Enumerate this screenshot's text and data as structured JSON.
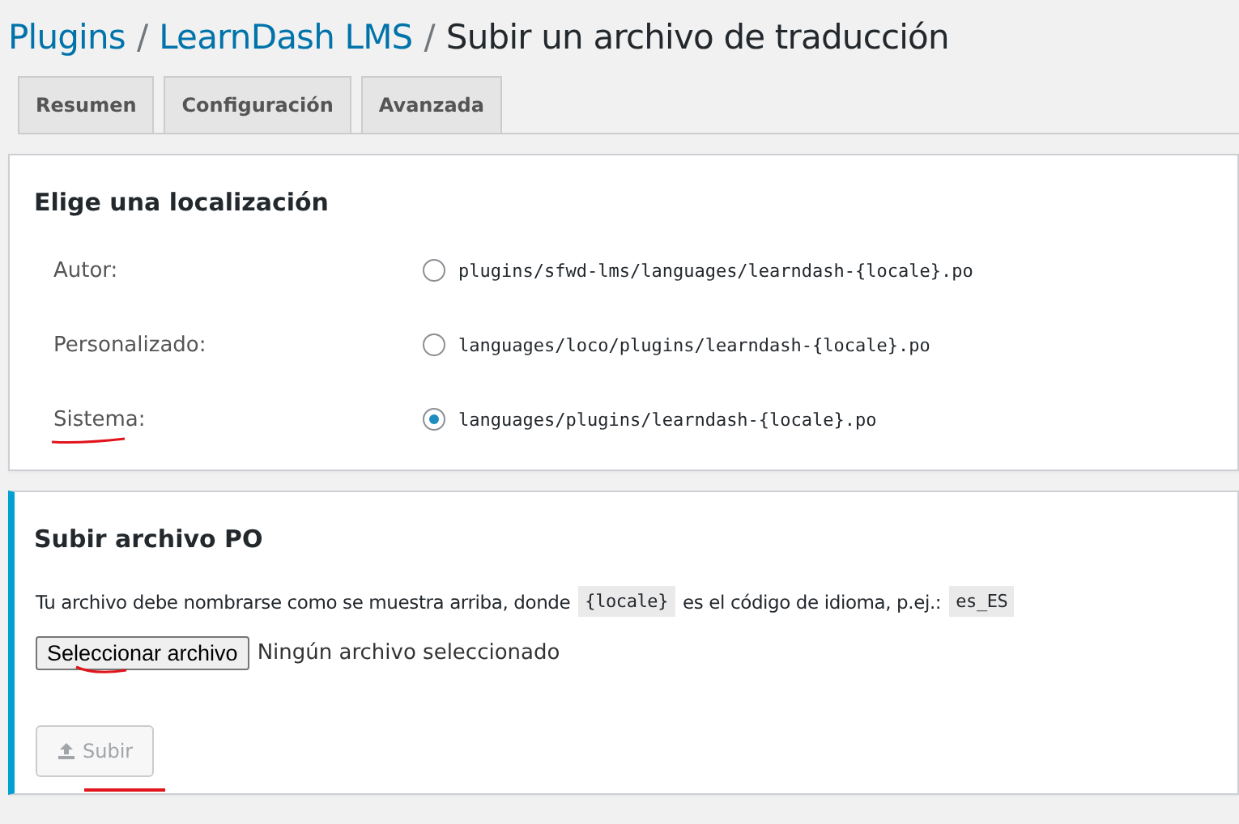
{
  "breadcrumb": [
    {
      "label": "Plugins",
      "kind": "link"
    },
    {
      "label": "/",
      "kind": "separator"
    },
    {
      "label": "LearnDash LMS",
      "kind": "link"
    },
    {
      "label": "/",
      "kind": "separator"
    },
    {
      "label": "Subir un archivo de traducción",
      "kind": "current"
    }
  ],
  "tabs": [
    {
      "label": "Resumen",
      "selected": false
    },
    {
      "label": "Configuración",
      "selected": false
    },
    {
      "label": "Avanzada",
      "selected": false
    }
  ],
  "locale_panel": {
    "heading": "Elige una localización",
    "options": [
      {
        "label": "Autor:",
        "path": "plugins/sfwd-lms/languages/learndash-{locale}.po",
        "selected": false
      },
      {
        "label": "Personalizado:",
        "path": "languages/loco/plugins/learndash-{locale}.po",
        "selected": false
      },
      {
        "label": "Sistema:",
        "path": "languages/plugins/learndash-{locale}.po",
        "selected": true
      }
    ]
  },
  "upload_panel": {
    "heading": "Subir archivo PO",
    "description": [
      {
        "kind": "text",
        "text": "Tu archivo debe nombrarse como se muestra arriba, donde"
      },
      {
        "kind": "code",
        "text": "{locale}"
      },
      {
        "kind": "text",
        "text": "es el código de idioma, p.ej.:"
      },
      {
        "kind": "code",
        "text": "es_ES"
      }
    ],
    "file_button": "Seleccionar archivo",
    "file_status": "Ningún archivo seleccionado",
    "submit": {
      "label": "Subir",
      "disabled": true
    }
  }
}
